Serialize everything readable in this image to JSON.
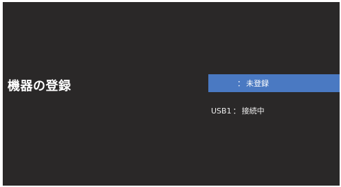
{
  "page": {
    "title": "機器の登録"
  },
  "devices": [
    {
      "name": "",
      "separator": "：",
      "status": "未登録",
      "selected": true
    },
    {
      "name": "USB1",
      "separator": "：",
      "status": "接続中",
      "selected": false
    }
  ],
  "colors": {
    "background": "#2a2828",
    "highlight": "#4a79c2",
    "text": "#ffffff"
  }
}
